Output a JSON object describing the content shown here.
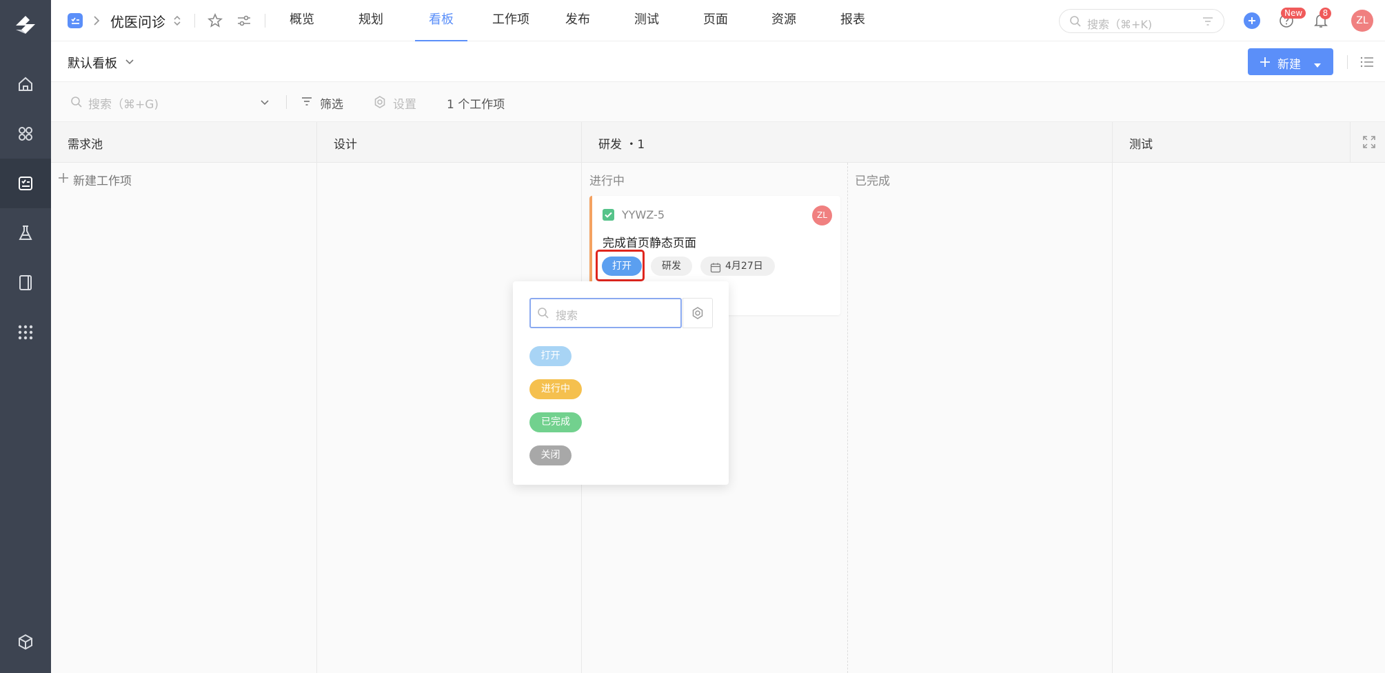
{
  "app": {
    "project_title": "优医问诊"
  },
  "nav_tabs": [
    {
      "label": "概览"
    },
    {
      "label": "规划"
    },
    {
      "label": "看板"
    },
    {
      "label": "工作项"
    },
    {
      "label": "发布"
    },
    {
      "label": "测试"
    },
    {
      "label": "页面"
    },
    {
      "label": "资源"
    },
    {
      "label": "报表"
    }
  ],
  "active_tab": "看板",
  "global_search": {
    "placeholder": "搜索（⌘+K)"
  },
  "header_badges": {
    "new": "New",
    "notifications": "8"
  },
  "user": {
    "initials": "ZL"
  },
  "board": {
    "name": "默认看板",
    "new_button": "新建"
  },
  "filterbar": {
    "search_placeholder": "搜索（⌘+G)",
    "filter_label": "筛选",
    "settings_label": "设置",
    "count_label": "1 个工作项"
  },
  "columns": [
    {
      "title": "需求池"
    },
    {
      "title": "设计"
    },
    {
      "title": "研发 ・1"
    },
    {
      "title": "测试"
    }
  ],
  "subcolumns": {
    "in_progress": "进行中",
    "done": "已完成"
  },
  "new_work_item": "新建工作项",
  "card": {
    "id": "YYWZ-5",
    "title": "完成首页静态页面",
    "status": "打开",
    "stage": "研发",
    "date": "4月27日",
    "assignee": "ZL"
  },
  "status_dropdown": {
    "search_placeholder": "搜索",
    "options": [
      {
        "label": "打开",
        "color": "#a8d4f5"
      },
      {
        "label": "进行中",
        "color": "#f5c04e"
      },
      {
        "label": "已完成",
        "color": "#72d18e"
      },
      {
        "label": "关闭",
        "color": "#a8a8a8"
      }
    ]
  },
  "colors": {
    "primary": "#5b8ff9",
    "rail": "#3d4451",
    "badge": "#f05a5a",
    "highlight": "#e0261e"
  }
}
